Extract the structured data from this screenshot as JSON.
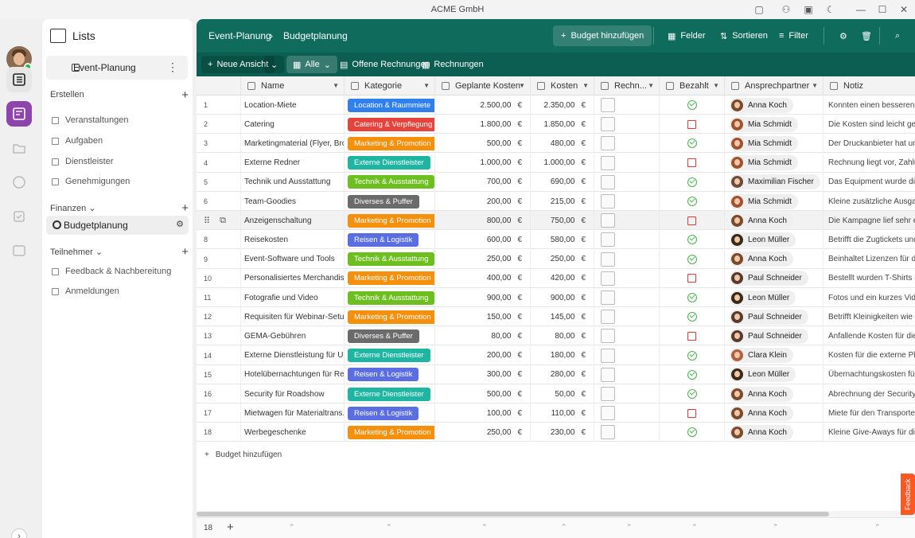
{
  "window": {
    "title": "ACME GmbH"
  },
  "app": {
    "title": "Lists"
  },
  "sidebar": {
    "project": "Event-Planung",
    "section_create": "Erstellen",
    "create_items": [
      {
        "label": "Veranstaltungen"
      },
      {
        "label": "Aufgaben"
      },
      {
        "label": "Dienstleister"
      },
      {
        "label": "Genehmigungen"
      }
    ],
    "section_finance": "Finanzen",
    "finance_active": "Budgetplanung",
    "section_participants": "Teilnehmer",
    "participant_items": [
      {
        "label": "Feedback & Nachbereitung"
      },
      {
        "label": "Anmeldungen"
      }
    ]
  },
  "topbar": {
    "crumb_root": "Event-Planung",
    "crumb_current": "Budgetplanung",
    "add_budget": "Budget hinzufügen",
    "fields": "Felder",
    "sort": "Sortieren",
    "filter": "Filter"
  },
  "viewbar": {
    "new_view": "Neue Ansicht",
    "all": "Alle",
    "open_invoices": "Offene Rechnungen",
    "invoices": "Rechnungen"
  },
  "columns": [
    "Name",
    "Kategorie",
    "Geplante Kosten",
    "Kosten",
    "Rechn...",
    "Bezahlt",
    "Ansprechpartner",
    "Notiz"
  ],
  "rows": [
    {
      "n": "1",
      "name": "Location-Miete",
      "cat": "Location & Raummiete",
      "catColor": "#2f80ed",
      "plan": "2.500,00",
      "cost": "2.350,00",
      "paid": true,
      "person": "Anna Koch",
      "note": "Konnten einen besseren Preis"
    },
    {
      "n": "2",
      "name": "Catering",
      "cat": "Catering & Verpflegung",
      "catColor": "#e5433c",
      "plan": "1.800,00",
      "cost": "1.850,00",
      "paid": false,
      "person": "Mia Schmidt",
      "note": "Die Kosten sind leicht gestieg"
    },
    {
      "n": "3",
      "name": "Marketingmaterial (Flyer, Bro...",
      "cat": "Marketing & Promotion",
      "catColor": "#f4900c",
      "plan": "500,00",
      "cost": "480,00",
      "paid": true,
      "person": "Mia Schmidt",
      "note": "Der Druckanbieter hat uns ei"
    },
    {
      "n": "4",
      "name": "Externe Redner",
      "cat": "Externe Dienstleister",
      "catColor": "#1fb5a3",
      "plan": "1.000,00",
      "cost": "1.000,00",
      "paid": false,
      "person": "Mia Schmidt",
      "note": "Rechnung liegt vor, Zahlung"
    },
    {
      "n": "5",
      "name": "Technik und Ausstattung",
      "cat": "Technik & Ausstattung",
      "catColor": "#6cbf1f",
      "plan": "700,00",
      "cost": "690,00",
      "paid": true,
      "person": "Maximilian Fischer",
      "note": "Das Equipment wurde direkt"
    },
    {
      "n": "6",
      "name": "Team-Goodies",
      "cat": "Diverses & Puffer",
      "catColor": "#6b6b6b",
      "plan": "200,00",
      "cost": "215,00",
      "paid": true,
      "person": "Mia Schmidt",
      "note": "Kleine zusätzliche Ausgaben"
    },
    {
      "n": "7",
      "name": "Anzeigenschaltung",
      "cat": "Marketing & Promotion",
      "catColor": "#f4900c",
      "plan": "800,00",
      "cost": "750,00",
      "paid": false,
      "person": "Anna Koch",
      "note": "Die Kampagne lief sehr effizi"
    },
    {
      "n": "8",
      "name": "Reisekosten",
      "cat": "Reisen & Logistik",
      "catColor": "#5b6ee1",
      "plan": "600,00",
      "cost": "580,00",
      "paid": true,
      "person": "Leon Müller",
      "note": "Betrifft die Zugtickets und Ho"
    },
    {
      "n": "9",
      "name": "Event-Software und Tools",
      "cat": "Technik & Ausstattung",
      "catColor": "#6cbf1f",
      "plan": "250,00",
      "cost": "250,00",
      "paid": true,
      "person": "Anna Koch",
      "note": "Beinhaltet Lizenzen für das U"
    },
    {
      "n": "10",
      "name": "Personalisiertes Merchandise",
      "cat": "Marketing & Promotion",
      "catColor": "#f4900c",
      "plan": "400,00",
      "cost": "420,00",
      "paid": false,
      "person": "Paul Schneider",
      "note": "Bestellt wurden T-Shirts und"
    },
    {
      "n": "11",
      "name": "Fotografie und Video",
      "cat": "Technik & Ausstattung",
      "catColor": "#6cbf1f",
      "plan": "900,00",
      "cost": "900,00",
      "paid": true,
      "person": "Leon Müller",
      "note": "Fotos und ein kurzes Video w"
    },
    {
      "n": "12",
      "name": "Requisiten für Webinar-Setup",
      "cat": "Marketing & Promotion",
      "catColor": "#f4900c",
      "plan": "150,00",
      "cost": "145,00",
      "paid": true,
      "person": "Paul Schneider",
      "note": "Betrifft Kleinigkeiten wie Pfla"
    },
    {
      "n": "13",
      "name": "GEMA-Gebühren",
      "cat": "Diverses & Puffer",
      "catColor": "#6b6b6b",
      "plan": "80,00",
      "cost": "80,00",
      "paid": false,
      "person": "Paul Schneider",
      "note": "Anfallende Kosten für die mu"
    },
    {
      "n": "14",
      "name": "Externe Dienstleistung für U...",
      "cat": "Externe Dienstleister",
      "catColor": "#1fb5a3",
      "plan": "200,00",
      "cost": "180,00",
      "paid": true,
      "person": "Clara Klein",
      "note": "Kosten für die externe Plattfo"
    },
    {
      "n": "15",
      "name": "Hotelübernachtungen für Re...",
      "cat": "Reisen & Logistik",
      "catColor": "#5b6ee1",
      "plan": "300,00",
      "cost": "280,00",
      "paid": true,
      "person": "Leon Müller",
      "note": "Übernachtungskosten für de"
    },
    {
      "n": "16",
      "name": "Security für Roadshow",
      "cat": "Externe Dienstleister",
      "catColor": "#1fb5a3",
      "plan": "500,00",
      "cost": "50,00",
      "paid": true,
      "person": "Anna Koch",
      "note": "Abrechnung der Security-Firm"
    },
    {
      "n": "17",
      "name": "Mietwagen für Materialtrans...",
      "cat": "Reisen & Logistik",
      "catColor": "#5b6ee1",
      "plan": "100,00",
      "cost": "110,00",
      "paid": false,
      "person": "Anna Koch",
      "note": "Miete für den Transporter zur"
    },
    {
      "n": "18",
      "name": "Werbegeschenke",
      "cat": "Marketing & Promotion",
      "catColor": "#f4900c",
      "plan": "250,00",
      "cost": "230,00",
      "paid": true,
      "person": "Anna Koch",
      "note": "Kleine Give-Aways für die Ro"
    }
  ],
  "currency": "€",
  "add_row_label": "Budget hinzufügen",
  "footer": {
    "count": "18",
    "plus": "+"
  },
  "feedback": "Feedback"
}
